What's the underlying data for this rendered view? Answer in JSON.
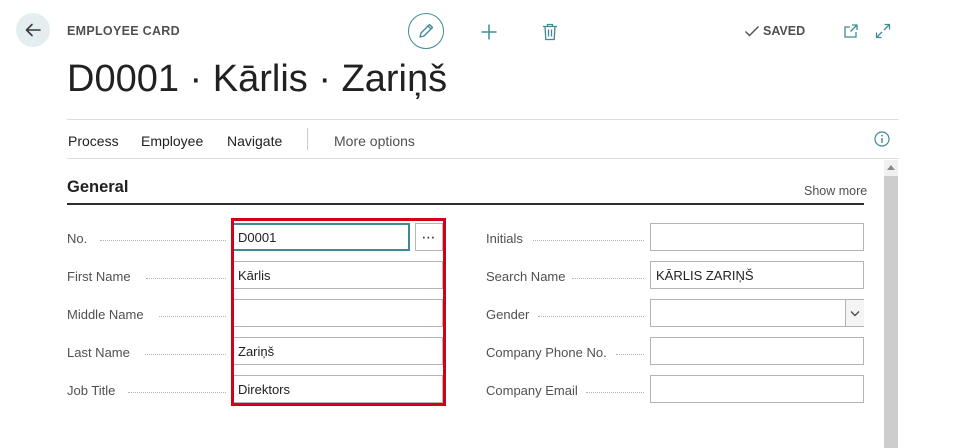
{
  "header": {
    "page_type": "EMPLOYEE CARD",
    "title": "D0001 · Kārlis · Zariņš",
    "saved_label": "SAVED"
  },
  "menu": {
    "items": [
      "Process",
      "Employee",
      "Navigate"
    ],
    "more_options": "More options"
  },
  "section": {
    "title": "General",
    "show_more": "Show more"
  },
  "fields": {
    "no": {
      "label": "No.",
      "value": "D0001"
    },
    "first_name": {
      "label": "First Name",
      "value": "Kārlis"
    },
    "middle_name": {
      "label": "Middle Name",
      "value": ""
    },
    "last_name": {
      "label": "Last Name",
      "value": "Zariņš"
    },
    "job_title": {
      "label": "Job Title",
      "value": "Direktors"
    },
    "initials": {
      "label": "Initials",
      "value": ""
    },
    "search_name": {
      "label": "Search Name",
      "value": "KĀRLIS ZARIŅŠ"
    },
    "gender": {
      "label": "Gender",
      "value": ""
    },
    "company_phone": {
      "label": "Company Phone No.",
      "value": ""
    },
    "company_email": {
      "label": "Company Email",
      "value": ""
    }
  },
  "lookup_label": "⋯",
  "icons": {
    "back": "arrow-left-icon",
    "edit": "pencil-icon",
    "new": "plus-icon",
    "delete": "trash-icon",
    "saved": "checkmark-icon",
    "open_new_window": "open-in-new-window-icon",
    "expand": "expand-icon",
    "info": "info-icon",
    "dropdown": "chevron-down-icon"
  },
  "colors": {
    "accent": "#3e8b96",
    "highlight": "#d0021b",
    "back_button_bg": "#e4eef0"
  }
}
